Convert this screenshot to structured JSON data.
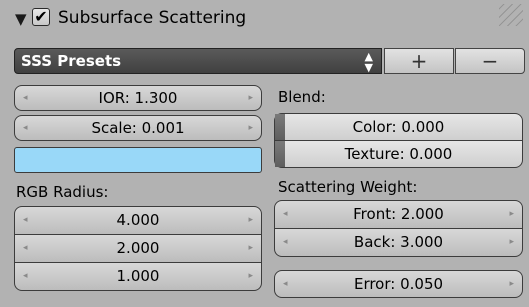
{
  "panel": {
    "title": "Subsurface Scattering",
    "enabled_mark": "✔",
    "collapse_icon": "▼"
  },
  "presets": {
    "label": "SSS Presets",
    "add_icon": "+",
    "remove_icon": "−"
  },
  "left": {
    "ior": "IOR: 1.300",
    "scale": "Scale: 0.001",
    "color_hex": "#99d8f8",
    "rgb_radius_label": "RGB Radius:",
    "radius": [
      "4.000",
      "2.000",
      "1.000"
    ]
  },
  "right": {
    "blend_label": "Blend:",
    "color": "Color: 0.000",
    "texture": "Texture: 0.000",
    "scattering_weight_label": "Scattering Weight:",
    "front": "Front: 2.000",
    "back": "Back: 3.000",
    "error": "Error: 0.050"
  },
  "arrows": {
    "left": "◂",
    "right": "▸"
  }
}
